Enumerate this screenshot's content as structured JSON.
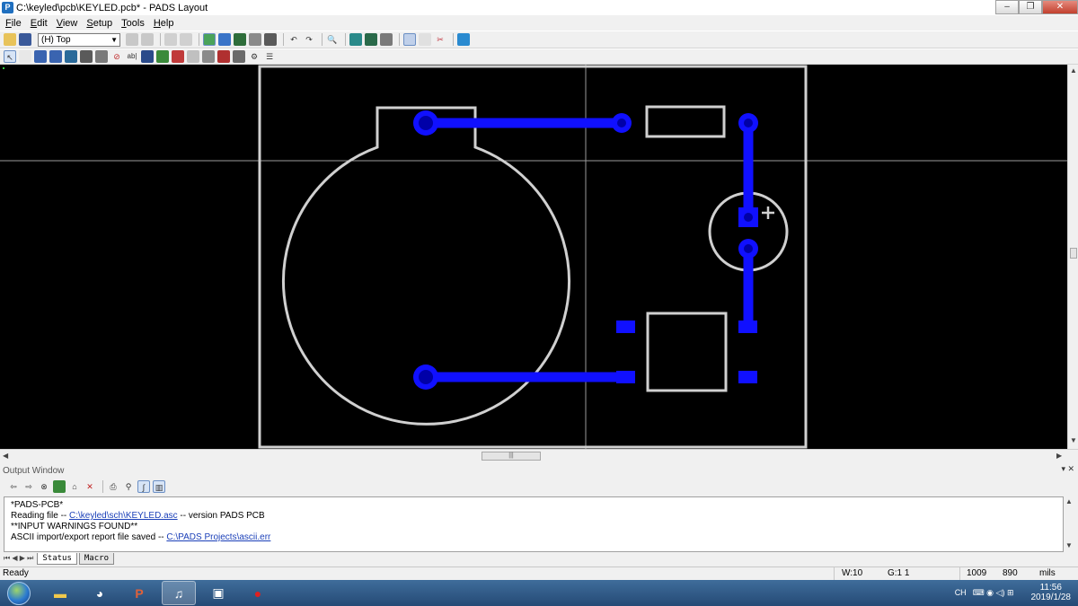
{
  "window": {
    "title": "C:\\keyled\\pcb\\KEYLED.pcb* - PADS Layout",
    "app_icon_glyph": "P",
    "minimize": "–",
    "maximize": "❐",
    "close": "✕"
  },
  "menu": {
    "items": [
      "File",
      "Edit",
      "View",
      "Setup",
      "Tools",
      "Help"
    ]
  },
  "toolbar": {
    "layer_select": "(H) Top"
  },
  "output": {
    "title": "Output Window",
    "header_controls": "▾  ✕",
    "lines": {
      "l1": "*PADS-PCB*",
      "l2_prefix": "Reading file -- ",
      "l2_link": "C:\\keyled\\sch\\KEYLED.asc",
      "l2_suffix": "  -- version PADS PCB",
      "l3": "**INPUT WARNINGS FOUND**",
      "l4_prefix": "ASCII import/export report file saved -- ",
      "l4_link": "C:\\PADS Projects\\ascii.err"
    },
    "tab_nav": "⏮ ◀ ▶ ⏭",
    "tabs": [
      "Status",
      "Macro"
    ]
  },
  "status": {
    "ready": "Ready",
    "width": "W:10",
    "grid": "G:1 1",
    "x": "1009",
    "y": "890",
    "units": "mils"
  },
  "taskbar": {
    "tray_lang": "CH",
    "tray_icons": "⌨  ◉  ◁)  ⊞",
    "time": "11:56",
    "date": "2019/1/28"
  },
  "colors": {
    "board_outline": "#d0d0d0",
    "copper": "#1010ff",
    "pad_hole": "#0000a8",
    "canvas": "#000000"
  }
}
